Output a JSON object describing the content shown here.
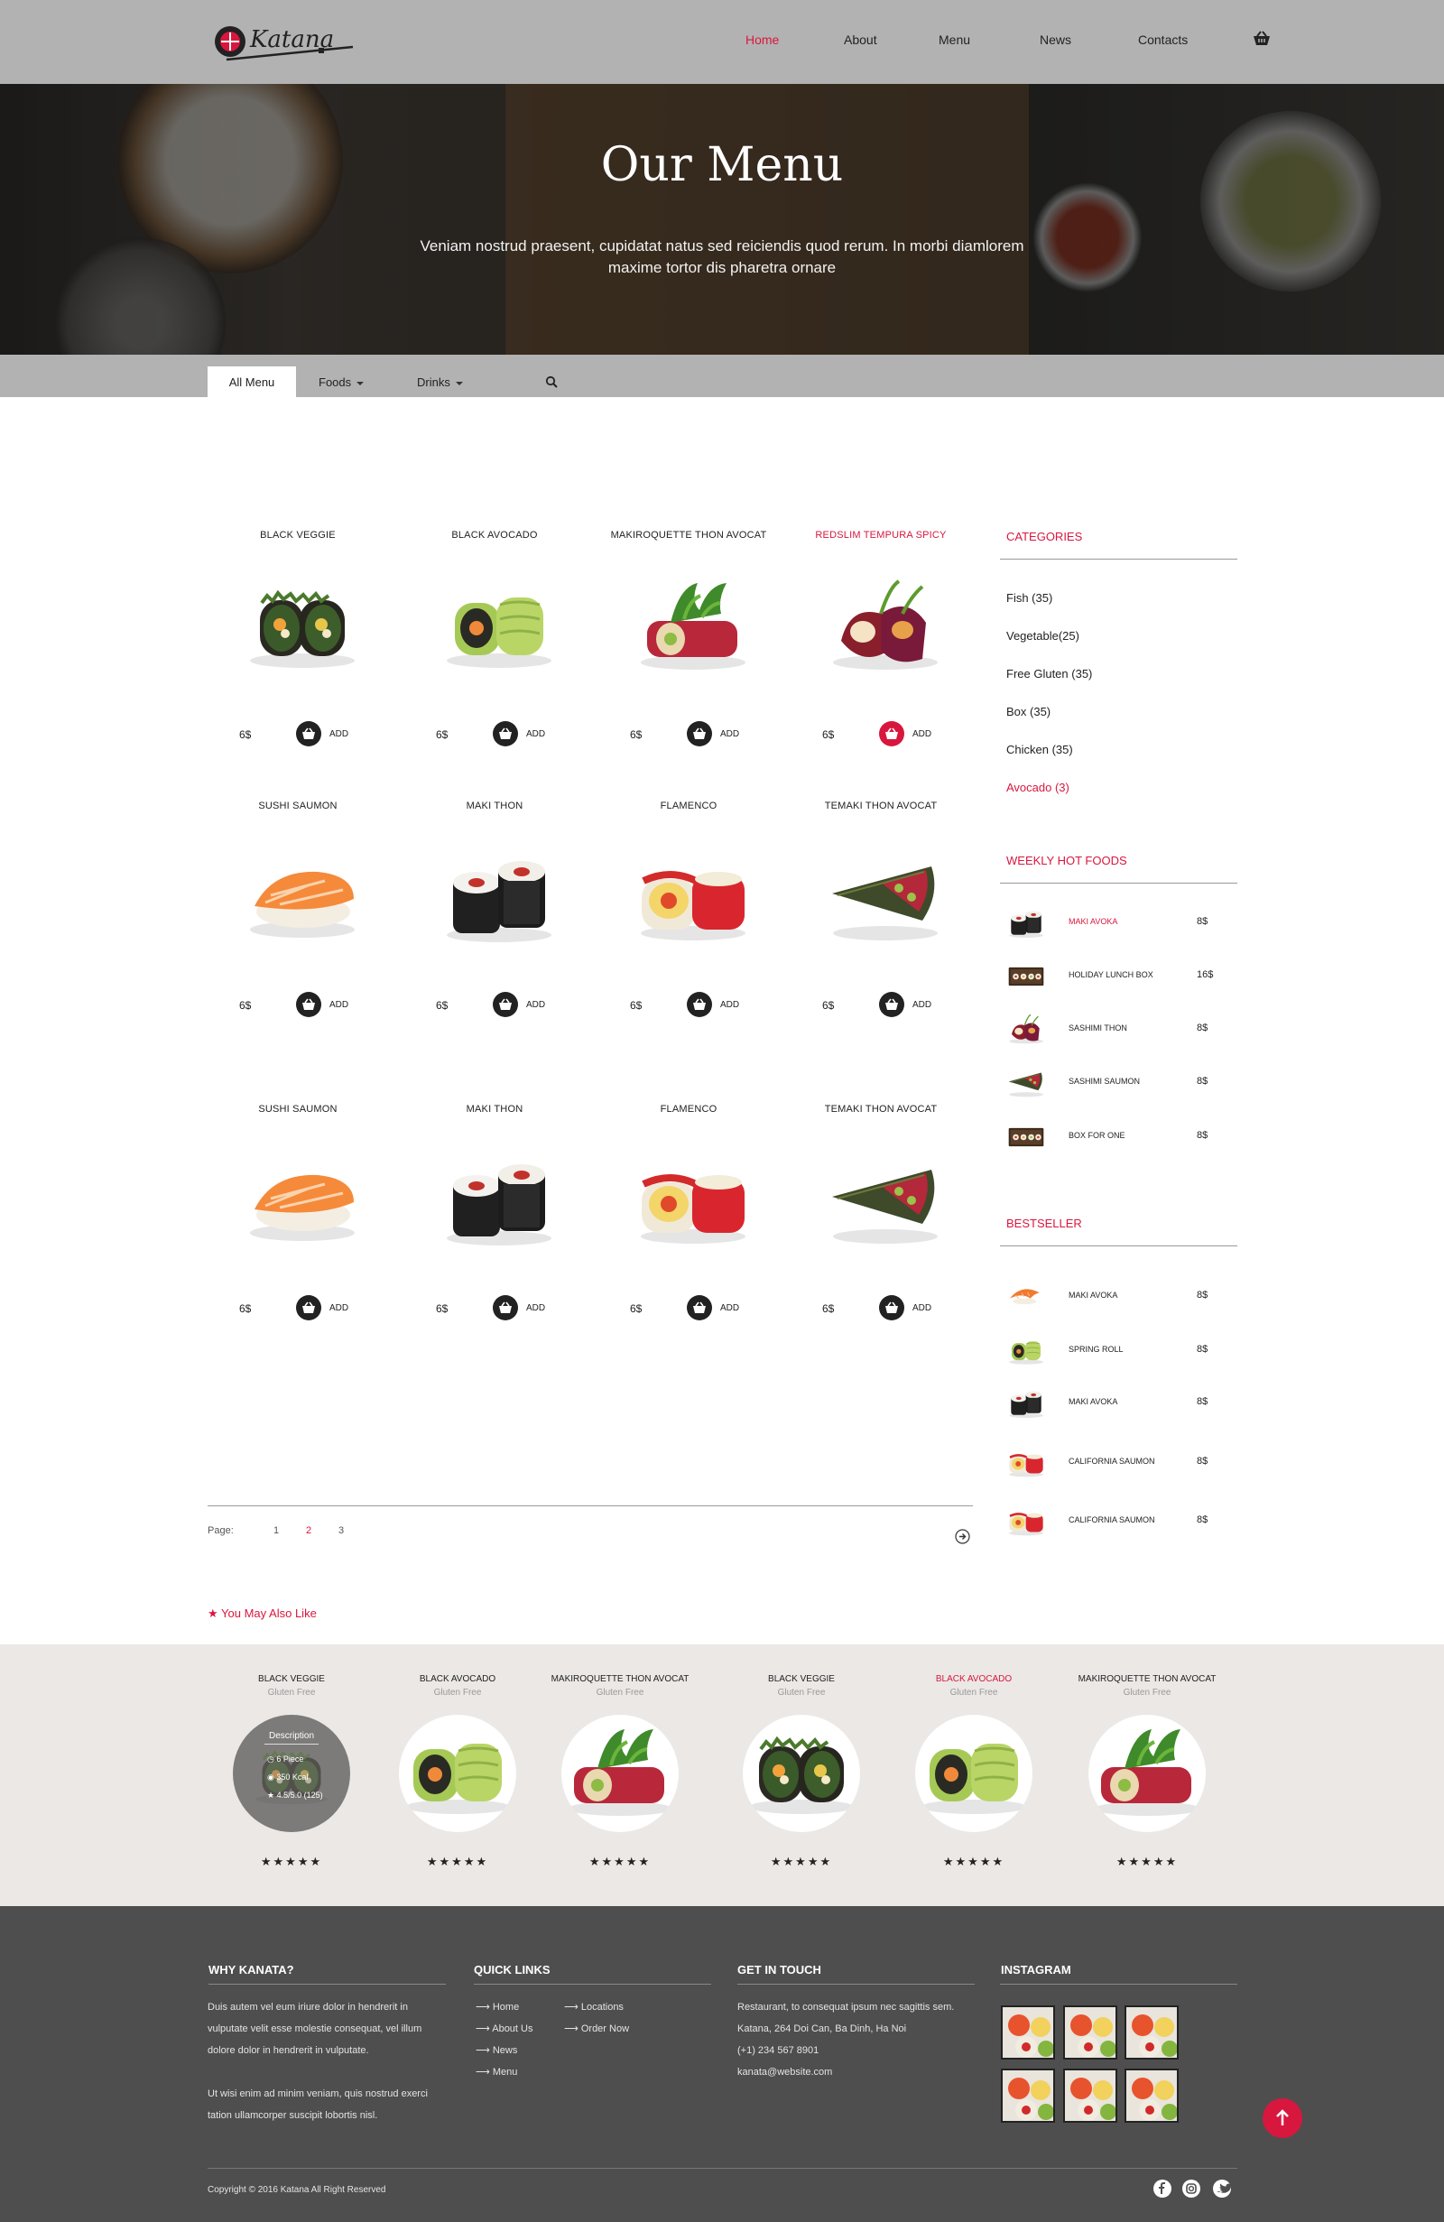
{
  "header": {
    "logo_text": "Katana",
    "nav": [
      "Home",
      "About",
      "Menu",
      "News",
      "Contacts"
    ],
    "active_nav": "Home"
  },
  "hero": {
    "title": "Our Menu",
    "subtitle": "Veniam nostrud praesent, cupidatat natus sed reiciendis quod rerum. In morbi diamlorem maxime tortor dis pharetra ornare"
  },
  "filters": {
    "all": "All Menu",
    "foods": "Foods",
    "drinks": "Drinks"
  },
  "add_label": "ADD",
  "products": [
    {
      "name": "BLACK VEGGIE",
      "price": "6$",
      "img": "veggie-roll"
    },
    {
      "name": "BLACK AVOCADO",
      "price": "6$",
      "img": "avocado-roll"
    },
    {
      "name": "MAKIROQUETTE THON AVOCAT",
      "price": "6$",
      "img": "tuna-roll"
    },
    {
      "name": "REDSLIM TEMPURA SPICY",
      "price": "6$",
      "img": "tempura-roll",
      "highlight": true
    },
    {
      "name": "SUSHI SAUMON",
      "price": "6$",
      "img": "salmon-nigiri"
    },
    {
      "name": "MAKI THON",
      "price": "6$",
      "img": "maki"
    },
    {
      "name": "FLAMENCO",
      "price": "6$",
      "img": "flamenco"
    },
    {
      "name": "TEMAKI THON AVOCAT",
      "price": "6$",
      "img": "temaki"
    },
    {
      "name": "SUSHI SAUMON",
      "price": "6$",
      "img": "salmon-nigiri"
    },
    {
      "name": "MAKI THON",
      "price": "6$",
      "img": "maki"
    },
    {
      "name": "FLAMENCO",
      "price": "6$",
      "img": "flamenco"
    },
    {
      "name": "TEMAKI THON AVOCAT",
      "price": "6$",
      "img": "temaki"
    }
  ],
  "sidebar": {
    "categories_title": "CATEGORIES",
    "categories": [
      "Fish (35)",
      "Vegetable(25)",
      "Free Gluten (35)",
      "Box (35)",
      "Chicken (35)",
      "Avocado (3)"
    ],
    "weekly_title": "WEEKLY HOT FOODS",
    "weekly": [
      {
        "name": "MAKI AVOKA",
        "price": "8$",
        "img": "maki",
        "highlight": true
      },
      {
        "name": "HOLIDAY LUNCH BOX",
        "price": "16$",
        "img": "box"
      },
      {
        "name": "SASHIMI THON",
        "price": "8$",
        "img": "tempura-roll"
      },
      {
        "name": "SASHIMI SAUMON",
        "price": "8$",
        "img": "temaki"
      },
      {
        "name": "BOX FOR ONE",
        "price": "8$",
        "img": "box"
      }
    ],
    "bestseller_title": "BESTSELLER",
    "bestseller": [
      {
        "name": "MAKI AVOKA",
        "price": "8$",
        "img": "shrimp"
      },
      {
        "name": "SPRING ROLL",
        "price": "8$",
        "img": "avocado-roll"
      },
      {
        "name": "MAKI AVOKA",
        "price": "8$",
        "img": "maki"
      },
      {
        "name": "CALIFORNIA SAUMON",
        "price": "8$",
        "img": "flamenco"
      },
      {
        "name": "CALIFORNIA SAUMON",
        "price": "8$",
        "img": "flamenco"
      }
    ]
  },
  "pagination": {
    "label": "Page:",
    "pages": [
      "1",
      "2",
      "3"
    ],
    "current": "2"
  },
  "also_like": {
    "title": "You May Also Like",
    "items": [
      {
        "name": "BLACK VEGGIE",
        "tag": "Gluten Free",
        "img": "veggie-roll",
        "hover": true
      },
      {
        "name": "BLACK AVOCADO",
        "tag": "Gluten Free",
        "img": "avocado-roll"
      },
      {
        "name": "MAKIROQUETTE THON AVOCAT",
        "tag": "Gluten Free",
        "img": "tuna-roll"
      },
      {
        "name": "BLACK VEGGIE",
        "tag": "Gluten Free",
        "img": "veggie-roll"
      },
      {
        "name": "BLACK AVOCADO",
        "tag": "Gluten Free",
        "img": "avocado-roll",
        "highlight": true
      },
      {
        "name": "MAKIROQUETTE THON AVOCAT",
        "tag": "Gluten Free",
        "img": "tuna-roll"
      }
    ],
    "stars": "★★★★★",
    "description": {
      "title": "Description",
      "pieces": "6 Piece",
      "kcal": "350 Kcal",
      "rating": "4.5/5.0 (125)"
    }
  },
  "footer": {
    "why_title": "WHY KANATA?",
    "why_p1": "Duis autem vel eum iriure dolor in hendrerit in vulputate velit esse molestie consequat, vel illum dolore dolor in hendrerit in vulputate.",
    "why_p2": "Ut wisi enim ad minim veniam, quis nostrud exerci tation ullamcorper suscipit lobortis nisl.",
    "links_title": "QUICK LINKS",
    "links_col1": [
      "Home",
      "About Us",
      "News",
      "Menu"
    ],
    "links_col2": [
      "Locations",
      "Order Now"
    ],
    "contact_title": "GET IN TOUCH",
    "contact_lines": [
      "Restaurant, to consequat ipsum nec sagittis sem.",
      "Katana, 264 Doi Can, Ba Dinh, Ha Noi",
      "(+1) 234 567 8901",
      "kanata@website.com"
    ],
    "instagram_title": "INSTAGRAM",
    "copyright": "Copyright © 2016 Katana All Right Reserved"
  },
  "colors": {
    "accent": "#d8173e",
    "header_bg": "#b3b2b2",
    "footer_bg": "#4e4e4e",
    "band_bg": "#ebe8e6"
  }
}
